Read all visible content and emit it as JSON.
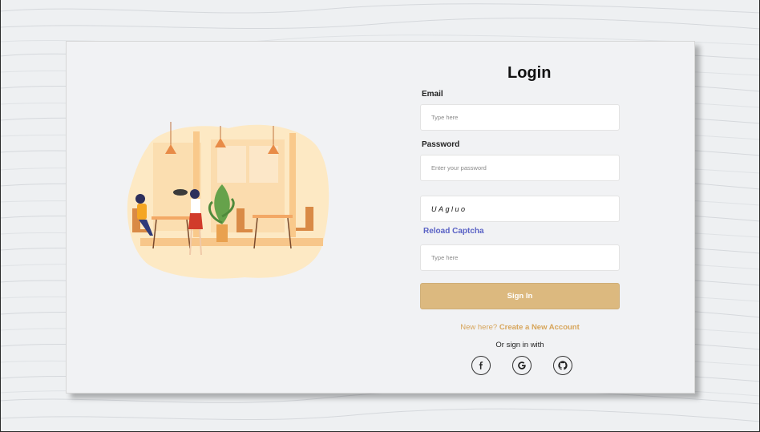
{
  "login": {
    "title": "Login",
    "email_label": "Email",
    "email_placeholder": "Type here",
    "password_label": "Password",
    "password_placeholder": "Enter your password",
    "captcha_text": "UAgluo",
    "reload_label": "Reload Captcha",
    "captcha_placeholder": "Type here",
    "signin_label": "Sign In",
    "new_here_text": "New here?",
    "create_account_label": "Create a New Account",
    "or_sign_in": "Or sign in with"
  },
  "social": [
    "facebook-icon",
    "google-icon",
    "github-icon"
  ],
  "colors": {
    "accent": "#dcb97f",
    "link_accent": "#d7a55a",
    "captcha_link": "#5a62c5",
    "background": "#eef0f2"
  }
}
